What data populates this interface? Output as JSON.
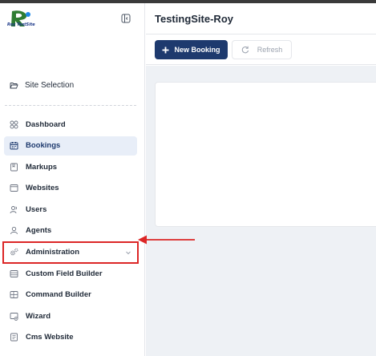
{
  "brand": {
    "logo_text": "Roy TestSite"
  },
  "header": {
    "title": "TestingSite-Roy"
  },
  "toolbar": {
    "new_booking_label": "New Booking",
    "refresh_label": "Refresh"
  },
  "sidebar": {
    "site_selection_label": "Site Selection",
    "items": [
      {
        "label": "Dashboard",
        "icon": "grid-icon"
      },
      {
        "label": "Bookings",
        "icon": "calendar-icon",
        "active": true
      },
      {
        "label": "Markups",
        "icon": "bookmark-icon"
      },
      {
        "label": "Websites",
        "icon": "browser-icon"
      },
      {
        "label": "Users",
        "icon": "user-icon"
      },
      {
        "label": "Agents",
        "icon": "agent-icon"
      },
      {
        "label": "Administration",
        "icon": "gears-icon",
        "expandable": true,
        "highlighted": true
      },
      {
        "label": "Custom Field Builder",
        "icon": "form-icon"
      },
      {
        "label": "Command Builder",
        "icon": "layout-icon"
      },
      {
        "label": "Wizard",
        "icon": "wizard-icon"
      },
      {
        "label": "Cms Website",
        "icon": "document-icon"
      }
    ]
  },
  "colors": {
    "primary": "#1e3a6e",
    "active_bg": "#e8eef8",
    "annotation": "#dc2626",
    "content_bg": "#eef1f5"
  }
}
